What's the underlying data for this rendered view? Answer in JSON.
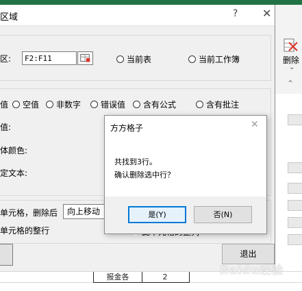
{
  "colors": {
    "excel_green": "#217346",
    "accent_blue": "#0078d7",
    "delete_red": "#d9342b"
  },
  "excel": {
    "ribbon": {
      "delete_label": "删除",
      "delete_icon": "delete-cells-icon"
    },
    "bottom_cells": [
      "报金各",
      "2"
    ]
  },
  "main_dialog": {
    "title": "区域",
    "help": "?",
    "close": "✕",
    "range": {
      "label": "区:",
      "value": "F2:F11"
    },
    "scope_options": [
      "当前表",
      "当前工作簿"
    ],
    "condition_fragment": "值",
    "condition_options": [
      "空值",
      "非数字",
      "错误值",
      "含有公式",
      "含有批注"
    ],
    "field_labels": [
      "值:",
      "体颜色:",
      "定文本:"
    ],
    "delete_after_label": "单元格，删除后",
    "direction_value": "向上移动",
    "entire_row_label": "单元格的整行",
    "entire_column_label": "此单元格的整列",
    "exit_button": "退出"
  },
  "message_box": {
    "title": "方方格子",
    "close": "✕",
    "line1": "共找到3行。",
    "line2": "确认删除选中行？",
    "yes_button": "是(Y)",
    "no_button": "否(N)"
  },
  "watermark": "Baidu经验"
}
